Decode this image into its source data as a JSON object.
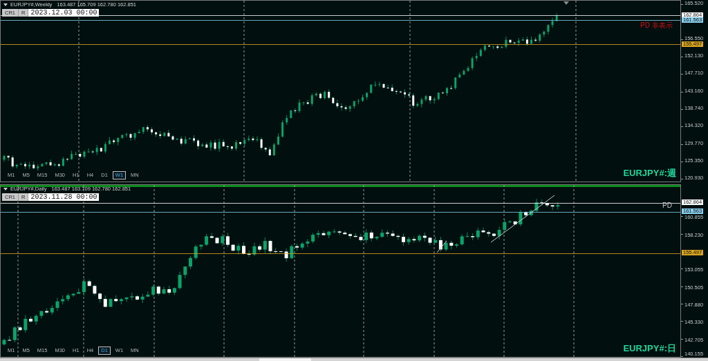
{
  "panes": [
    {
      "title": "EURJPY#,Weekly",
      "ohlc": "163.487 165.709 162.780 162.851",
      "buttons": [
        "CR1",
        "R"
      ],
      "date": "2023.12.03 00:00",
      "price_axis": [
        "165.520",
        "156.550",
        "152.130",
        "147.710",
        "143.160",
        "138.740",
        "134.320",
        "129.770",
        "125.350",
        "120.930"
      ],
      "price_lines": [
        {
          "label": "162.864",
          "color": "#ffffff"
        },
        {
          "label": "161.563",
          "color": "#87ceeb"
        },
        {
          "label": "155.497",
          "color": "#daa520"
        }
      ],
      "note": "PD 非表示",
      "note_alert": true,
      "symbol_label": "EURJPY#:週",
      "timeframes": [
        {
          "label": "M1",
          "selected": false
        },
        {
          "label": "M5",
          "selected": false
        },
        {
          "label": "M15",
          "selected": false
        },
        {
          "label": "M30",
          "selected": false
        },
        {
          "label": "H1",
          "selected": false
        },
        {
          "label": "H4",
          "selected": false
        },
        {
          "label": "D1",
          "selected": false
        },
        {
          "label": "W1",
          "selected": true
        },
        {
          "label": "MN",
          "selected": false
        }
      ]
    },
    {
      "title": "EURJPY#,Daily",
      "ohlc": "163.487 163.709 162.780 162.851",
      "buttons": [
        "CR1",
        "R"
      ],
      "date": "2023.11.28 00:00",
      "price_axis": [
        "160.855",
        "158.230",
        "153.055",
        "150.505",
        "147.880",
        "145.330",
        "142.705",
        "140.155"
      ],
      "price_lines": [
        {
          "label": "162.864",
          "color": "#ffffff"
        },
        {
          "label": "161.563",
          "color": "#87ceeb"
        },
        {
          "label": "155.497",
          "color": "#daa520"
        }
      ],
      "note": "PD",
      "note_alert": false,
      "symbol_label": "EURJPY#:日",
      "timeframes": [
        {
          "label": "M1",
          "selected": false
        },
        {
          "label": "M5",
          "selected": false
        },
        {
          "label": "M15",
          "selected": false
        },
        {
          "label": "M30",
          "selected": false
        },
        {
          "label": "H1",
          "selected": false
        },
        {
          "label": "H4",
          "selected": false
        },
        {
          "label": "D1",
          "selected": true
        },
        {
          "label": "W1",
          "selected": false
        },
        {
          "label": "MN",
          "selected": false
        }
      ]
    }
  ]
}
